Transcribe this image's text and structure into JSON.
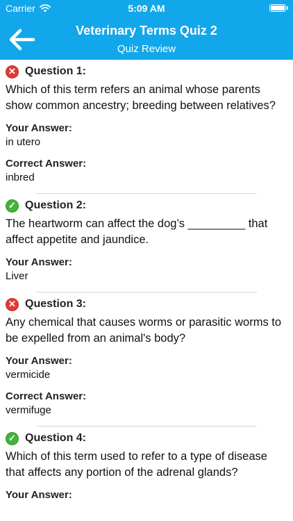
{
  "status_bar": {
    "carrier": "Carrier",
    "time": "5:09 AM"
  },
  "header": {
    "title": "Veterinary Terms Quiz 2",
    "subtitle": "Quiz Review",
    "background_color": "#12a7ea"
  },
  "labels": {
    "your_answer": "Your Answer:",
    "correct_answer": "Correct Answer:"
  },
  "questions": [
    {
      "heading": "Question 1:",
      "status": "wrong",
      "status_icon": "cross-icon",
      "text": "Which of this term refers an animal whose parents show common ancestry; breeding between relatives?",
      "your_answer": "in utero",
      "correct_answer": "inbred"
    },
    {
      "heading": "Question 2:",
      "status": "correct",
      "status_icon": "check-icon",
      "text": "The heartworm can affect the dog’s _________ that affect appetite and jaundice.",
      "your_answer": "Liver"
    },
    {
      "heading": "Question 3:",
      "status": "wrong",
      "status_icon": "cross-icon",
      "text": "Any chemical that causes worms or parasitic worms to be expelled from an animal's body?",
      "your_answer": "vermicide",
      "correct_answer": "vermifuge"
    },
    {
      "heading": "Question 4:",
      "status": "correct",
      "status_icon": "check-icon",
      "text": "Which of this term used to refer to a type of disease that affects any portion of the adrenal glands?",
      "your_answer": ""
    }
  ],
  "colors": {
    "wrong": "#e53935",
    "correct": "#43b33a"
  }
}
